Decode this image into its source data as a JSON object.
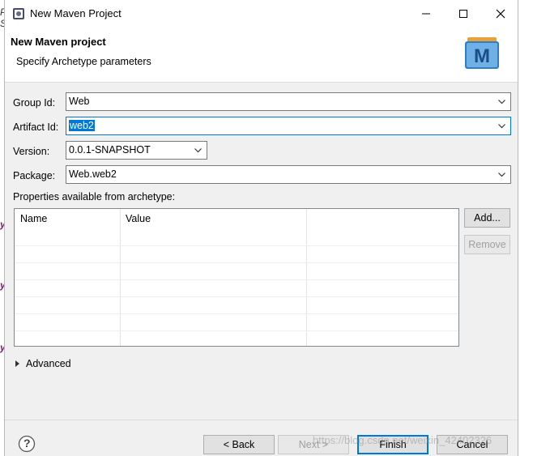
{
  "window": {
    "title": "New Maven Project"
  },
  "header": {
    "title": "New Maven project",
    "subtitle": "Specify Archetype parameters"
  },
  "form": {
    "group_id": {
      "label": "Group Id:",
      "value": "Web"
    },
    "artifact_id": {
      "label": "Artifact Id:",
      "value": "web2"
    },
    "version": {
      "label": "Version:",
      "value": "0.0.1-SNAPSHOT"
    },
    "package": {
      "label": "Package:",
      "value": "Web.web2"
    }
  },
  "properties": {
    "label": "Properties available from archetype:",
    "columns": [
      "Name",
      "Value"
    ],
    "add_label": "Add...",
    "remove_label": "Remove"
  },
  "advanced": {
    "label": "Advanced"
  },
  "footer": {
    "help_label": "?",
    "back_label": "< Back",
    "next_label": "Next >",
    "finish_label": "Finish",
    "cancel_label": "Cancel"
  },
  "watermark": "https://blog.csdn.net/weixin_42402326",
  "colors": {
    "accent": "#0078d7",
    "dialog_bg": "#f0f0f0"
  }
}
